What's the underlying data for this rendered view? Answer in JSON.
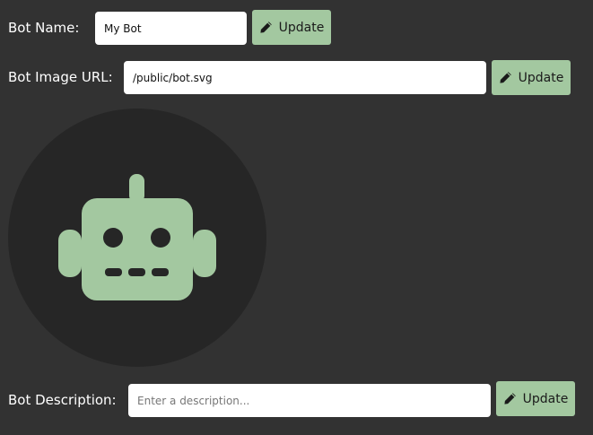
{
  "bot_name": {
    "label": "Bot Name:",
    "value": "My Bot",
    "button_label": "Update"
  },
  "bot_image_url": {
    "label": "Bot Image URL:",
    "value": "/public/bot.svg",
    "button_label": "Update"
  },
  "bot_description": {
    "label": "Bot Description:",
    "value": "",
    "placeholder": "Enter a description...",
    "button_label": "Update"
  },
  "colors": {
    "background": "#323232",
    "avatar_background": "#262626",
    "accent": "#a3c8a0",
    "input_background": "#ffffff"
  },
  "icons": {
    "update_button": "pencil-icon",
    "avatar": "robot-icon"
  }
}
